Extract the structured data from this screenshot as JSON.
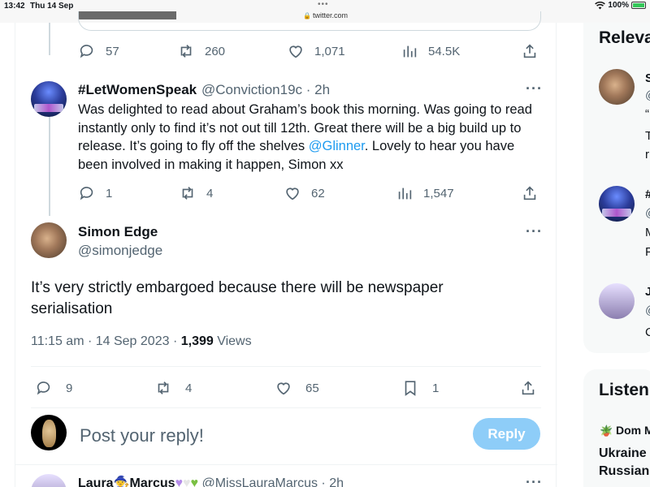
{
  "status_bar": {
    "time": "13:42",
    "date": "Thu 14 Sep",
    "dots": "•••",
    "url": "twitter.com",
    "battery": "100%"
  },
  "previous_tweet_actions": {
    "replies": "57",
    "retweets": "260",
    "likes": "1,071",
    "views": "54.5K"
  },
  "reply_tweet": {
    "display_name": "#LetWomenSpeak",
    "handle_time": "@Conviction19c · 2h",
    "text_before_mention": "Was delighted to read about Graham’s book this morning. Was going to read instantly only to find it’s not out till 12th. Great there will be a big build up to release. It’s going to fly off the shelves ",
    "mention": "@Glinner",
    "text_after_mention": ". Lovely to hear you have been involved in making it happen, Simon xx",
    "replies": "1",
    "retweets": "4",
    "likes": "62",
    "views": "1,547"
  },
  "main_tweet": {
    "display_name": "Simon Edge",
    "handle": "@simonjedge",
    "text": "It’s very strictly embargoed because there will be newspaper serialisation",
    "timestamp": "11:15 am · 14 Sep 2023 · ",
    "views_count": "1,399",
    "views_label": " Views",
    "replies": "9",
    "retweets": "4",
    "likes": "65",
    "bookmarks": "1"
  },
  "composer": {
    "placeholder": "Post your reply!",
    "button_label": "Reply"
  },
  "next_tweet": {
    "display_name": "Laura",
    "display_name_2": "Marcus",
    "handle_time": "@MissLauraMarcus · 2h"
  },
  "sidebar": {
    "relevant_title": "Relevant",
    "listen_title": "Listen",
    "frag_s": "S",
    "frag_at1": "@",
    "frag_quote": "“",
    "frag_t": "T",
    "frag_r": "r",
    "frag_hash": "#",
    "frag_at2": "@",
    "frag_m": "M",
    "frag_f": "F",
    "frag_j": "J",
    "frag_at3": "@",
    "frag_c": "C",
    "dom": "Dom M",
    "ukraine": "Ukraine",
    "russian": "Russian"
  },
  "colors": {
    "accent": "#1d9bf0",
    "reply_button_disabled": "#8ecdf8",
    "secondary_text": "#536471"
  }
}
